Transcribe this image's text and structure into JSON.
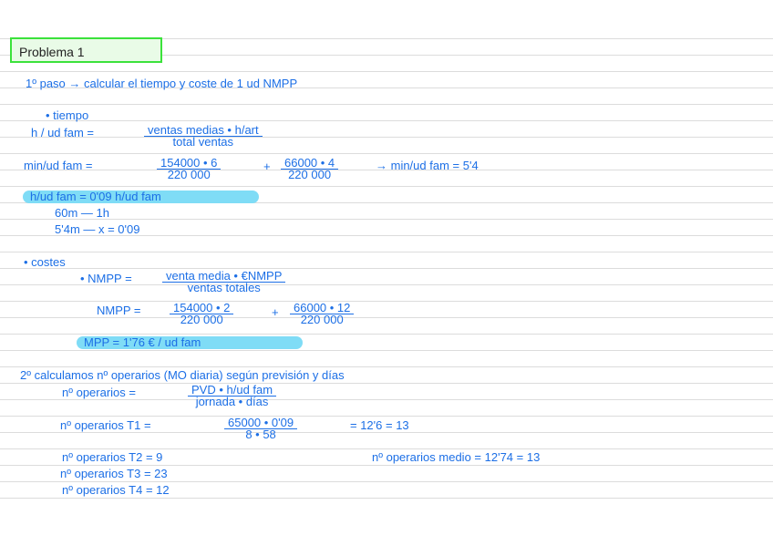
{
  "title": "Problema 1",
  "step1": "1º paso → calcular el tiempo y coste de 1 ud NMPP",
  "tiempo": {
    "bullet": "• tiempo",
    "formula_lhs": "h / ud fam =",
    "formula_num": "ventas medias • h/art",
    "formula_den": "total ventas",
    "min_lhs": "min/ud fam =",
    "min_num1": "154000 • 6",
    "min_den1": "220 000",
    "plus": "+",
    "min_num2": "66000 • 4",
    "min_den2": "220 000",
    "min_result": "→ min/ud fam = 5'4",
    "highlight": "h/ud fam = 0'09 h/ud fam",
    "rule1": "60m — 1h",
    "rule2": "5'4m — x = 0'09"
  },
  "costes": {
    "bullet": "• costes",
    "formula_lhs": "• NMPP =",
    "formula_num": "venta media • €NMPP",
    "formula_den": "ventas totales",
    "calc_lhs": "NMPP =",
    "calc_num1": "154000 • 2",
    "calc_den1": "220 000",
    "plus": "+",
    "calc_num2": "66000 • 12",
    "calc_den2": "220 000",
    "highlight": "MPP = 1'76 € / ud fam"
  },
  "step2": {
    "heading": "2º calculamos nº operarios (MO diaria) según previsión y días",
    "formula_lhs": "nº operarios =",
    "formula_num": "PVD • h/ud fam",
    "formula_den": "jornada • días",
    "t1_lhs": "nº operarios T1 =",
    "t1_num": "65000 • 0'09",
    "t1_den": "8 • 58",
    "t1_result": "= 12'6 = 13",
    "t2": "nº operarios T2 = 9",
    "t3": "nº operarios T3 = 23",
    "t4": "nº operarios T4 = 12",
    "medio": "nº operarios medio = 12'74 = 13"
  }
}
